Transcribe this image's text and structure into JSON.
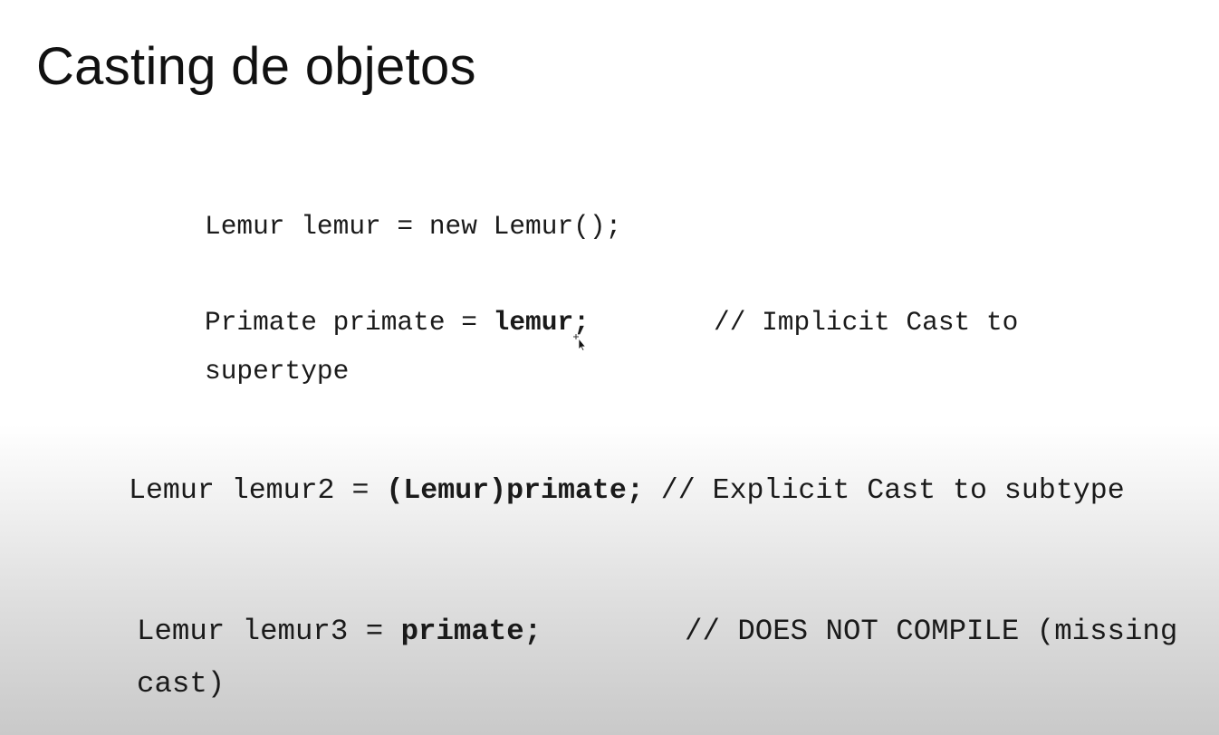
{
  "slide": {
    "title": "Casting de objetos",
    "lines": [
      {
        "code": "Lemur lemur = new Lemur();"
      },
      {
        "code_plain": "Primate primate = ",
        "code_bold": "lemur;",
        "comment": "// Implicit Cast to",
        "continuation": "supertype"
      },
      {
        "code_plain": "Lemur lemur2 = ",
        "code_bold": "(Lemur)primate;",
        "comment": "// Explicit Cast to subtype"
      },
      {
        "code_plain": "Lemur lemur3 = ",
        "code_bold": "primate;",
        "comment": "// DOES NOT COMPILE (missing",
        "continuation": "cast)"
      }
    ]
  }
}
